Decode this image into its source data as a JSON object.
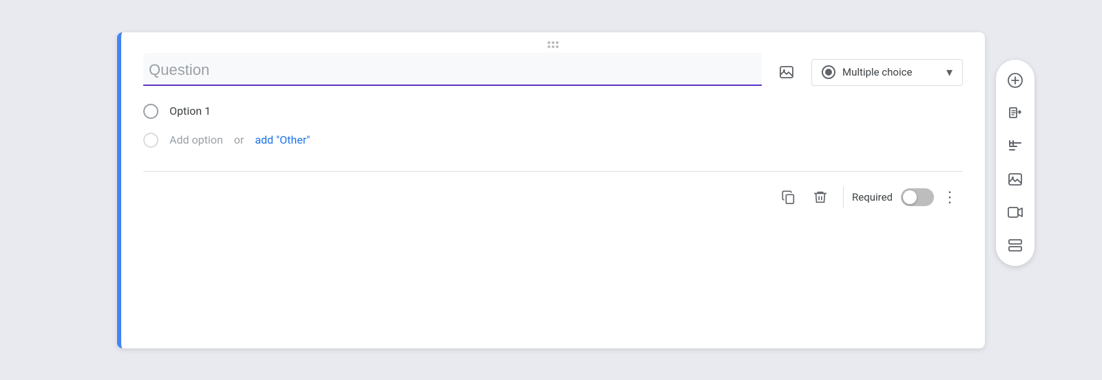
{
  "card": {
    "drag_handle": "⋮⋮",
    "question_placeholder": "Question",
    "question_value": "",
    "type_label": "Multiple choice",
    "option1_label": "Option 1",
    "add_option_text": "Add option",
    "or_text": "or",
    "add_other_text": "add \"Other\"",
    "required_label": "Required",
    "footer": {
      "duplicate_title": "Duplicate",
      "delete_title": "Delete",
      "more_title": "More options"
    }
  },
  "sidebar": {
    "buttons": [
      {
        "name": "add-question-btn",
        "title": "Add question",
        "icon": "plus-circle"
      },
      {
        "name": "import-question-btn",
        "title": "Import questions",
        "icon": "import"
      },
      {
        "name": "add-title-btn",
        "title": "Add title and description",
        "icon": "title"
      },
      {
        "name": "add-image-btn",
        "title": "Add image",
        "icon": "image"
      },
      {
        "name": "add-video-btn",
        "title": "Add video",
        "icon": "video"
      },
      {
        "name": "add-section-btn",
        "title": "Add section",
        "icon": "section"
      }
    ]
  }
}
